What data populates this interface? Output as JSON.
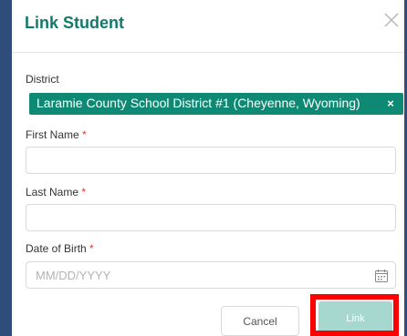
{
  "dialog": {
    "title": "Link Student",
    "close_icon": "close-icon"
  },
  "district": {
    "label": "District",
    "selected": "Laramie County School District #1 (Cheyenne, Wyoming)",
    "remove_glyph": "×"
  },
  "first_name": {
    "label": "First Name",
    "required_mark": "*",
    "value": ""
  },
  "last_name": {
    "label": "Last Name",
    "required_mark": "*",
    "value": ""
  },
  "dob": {
    "label": "Date of Birth",
    "required_mark": "*",
    "placeholder": "MM/DD/YYYY",
    "icon": "calendar-icon"
  },
  "actions": {
    "cancel_label": "Cancel",
    "link_label": "Link"
  },
  "colors": {
    "accent": "#127a6b",
    "chip": "#0e8a74",
    "link_disabled": "#a6d8d0",
    "required": "#d13b3b",
    "highlight": "#ff0000",
    "frame": "#2f4d7a"
  }
}
